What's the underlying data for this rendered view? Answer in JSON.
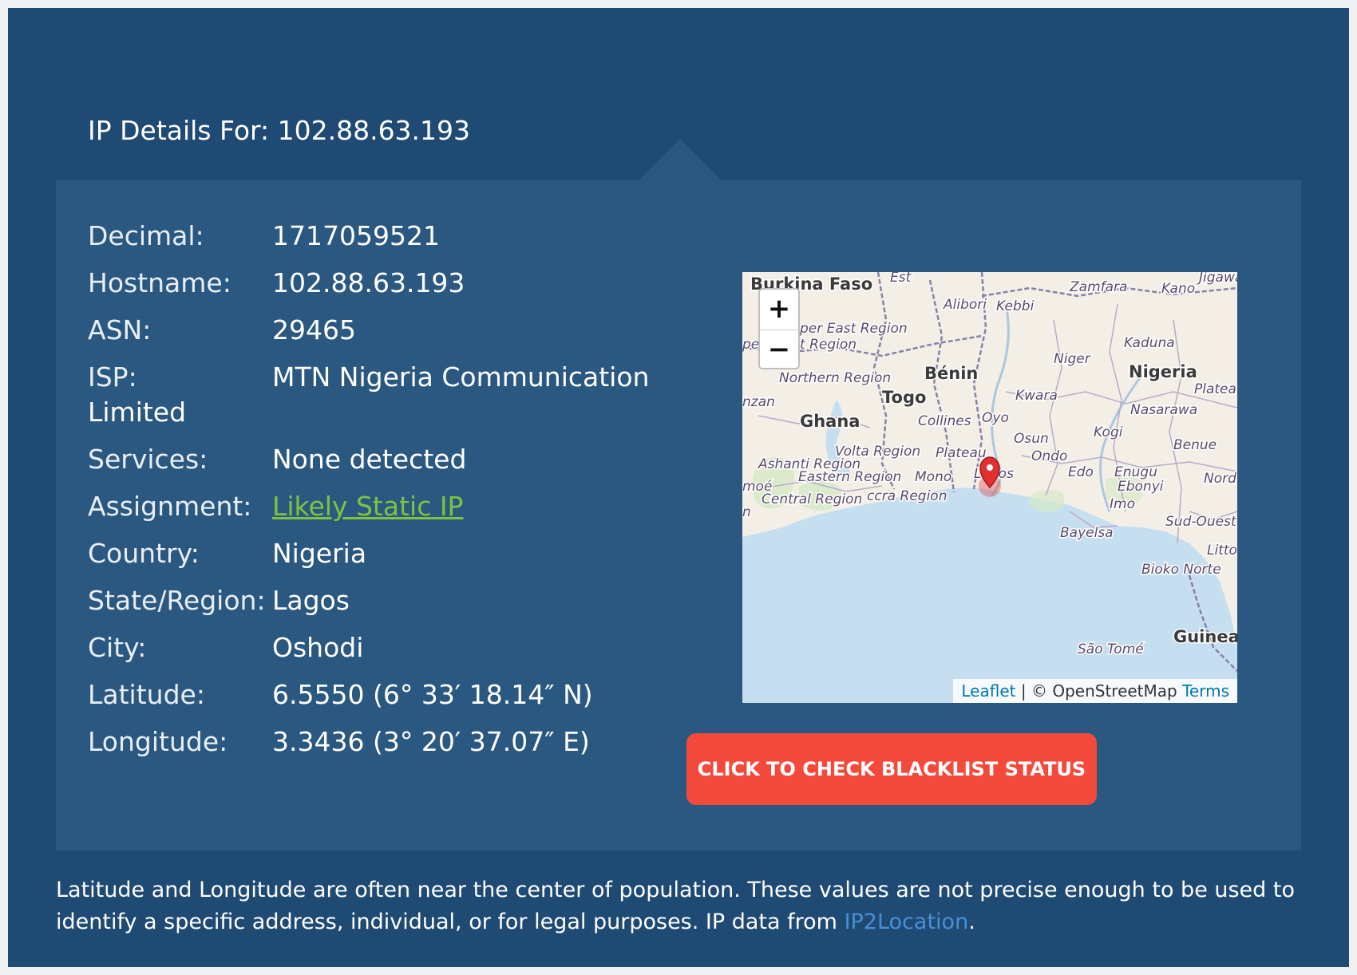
{
  "header": {
    "title": "IP Details For: 102.88.63.193"
  },
  "details": [
    {
      "label": "Decimal:",
      "value": "1717059521"
    },
    {
      "label": "Hostname:",
      "value": "102.88.63.193"
    },
    {
      "label": "ASN:",
      "value": "29465"
    },
    {
      "label": "ISP:",
      "value": "MTN Nigeria Communication",
      "continuation": "Limited"
    },
    {
      "label": "Services:",
      "value": "None detected"
    },
    {
      "label": "Assignment:",
      "value": "Likely Static IP"
    },
    {
      "label": "Country:",
      "value": "Nigeria"
    },
    {
      "label": "State/Region:",
      "value": "Lagos"
    },
    {
      "label": "City:",
      "value": "Oshodi"
    },
    {
      "label": "Latitude:",
      "value": "6.5550 (6° 33′ 18.14″ N)"
    },
    {
      "label": "Longitude:",
      "value": "3.3436 (3° 20′ 37.07″ E)"
    }
  ],
  "map": {
    "zoom_in": "+",
    "zoom_out": "−",
    "attribution": {
      "leaflet": "Leaflet",
      "separator": "|",
      "osm": "© OpenStreetMap",
      "terms": "Terms"
    },
    "labels": {
      "burkina_faso": "Burkina Faso",
      "est": "Est",
      "alibori": "Alibori",
      "kebbi": "Kebbi",
      "zamfara": "Zamfara",
      "kano": "Kano",
      "jigawa": "Jigawa",
      "upper_east": "per East Region",
      "upper_east2": "t Region",
      "pe": "pe",
      "kaduna": "Kaduna",
      "niger": "Niger",
      "northern_region": "Northern Region",
      "benin": "Bénin",
      "nigeria": "Nigeria",
      "plateau": "Plateau",
      "zan": "nzan",
      "togo": "Togo",
      "kwara": "Kwara",
      "nasarawa": "Nasarawa",
      "ghana": "Ghana",
      "collines": "Collines",
      "oyo": "Oyo",
      "kogi": "Kogi",
      "osun": "Osun",
      "benue": "Benue",
      "volta": "Volta Region",
      "plateau2": "Plateau",
      "ondo": "Ondo",
      "ashanti": "Ashanti Region",
      "eastern": "Eastern Region",
      "mono": "Mono",
      "lagos": "Lagos",
      "edo": "Edo",
      "enugu": "Enugu",
      "ebonyi": "Ebonyi",
      "nord": "Nord",
      "moe": "moé",
      "central": "Central Region",
      "accra": "ccra Region",
      "imo": "Imo",
      "n": "n",
      "sud_ouest": "Sud-Ouest",
      "bayelsa": "Bayelsa",
      "litto": "Litto",
      "bioko": "Bioko Norte",
      "guinea": "Guinea",
      "sao_tome": "São Tomé"
    }
  },
  "actions": {
    "blacklist_button": "CLICK TO CHECK BLACKLIST STATUS"
  },
  "footer": {
    "disclaimer_text": "Latitude and Longitude are often near the center of population. These values are not precise enough to be used to identify a specific address, individual, or for legal purposes. IP data from ",
    "source_link": "IP2Location",
    "end": "."
  },
  "colors": {
    "frame_bg": "#1f4a73",
    "panel_bg": "#2b5880",
    "button_red": "#f34a3c",
    "link_green": "#7ec242",
    "link_blue": "#4a8fd6",
    "water": "#c5dff0",
    "land": "#f4efe6",
    "marker": "#e03030"
  }
}
